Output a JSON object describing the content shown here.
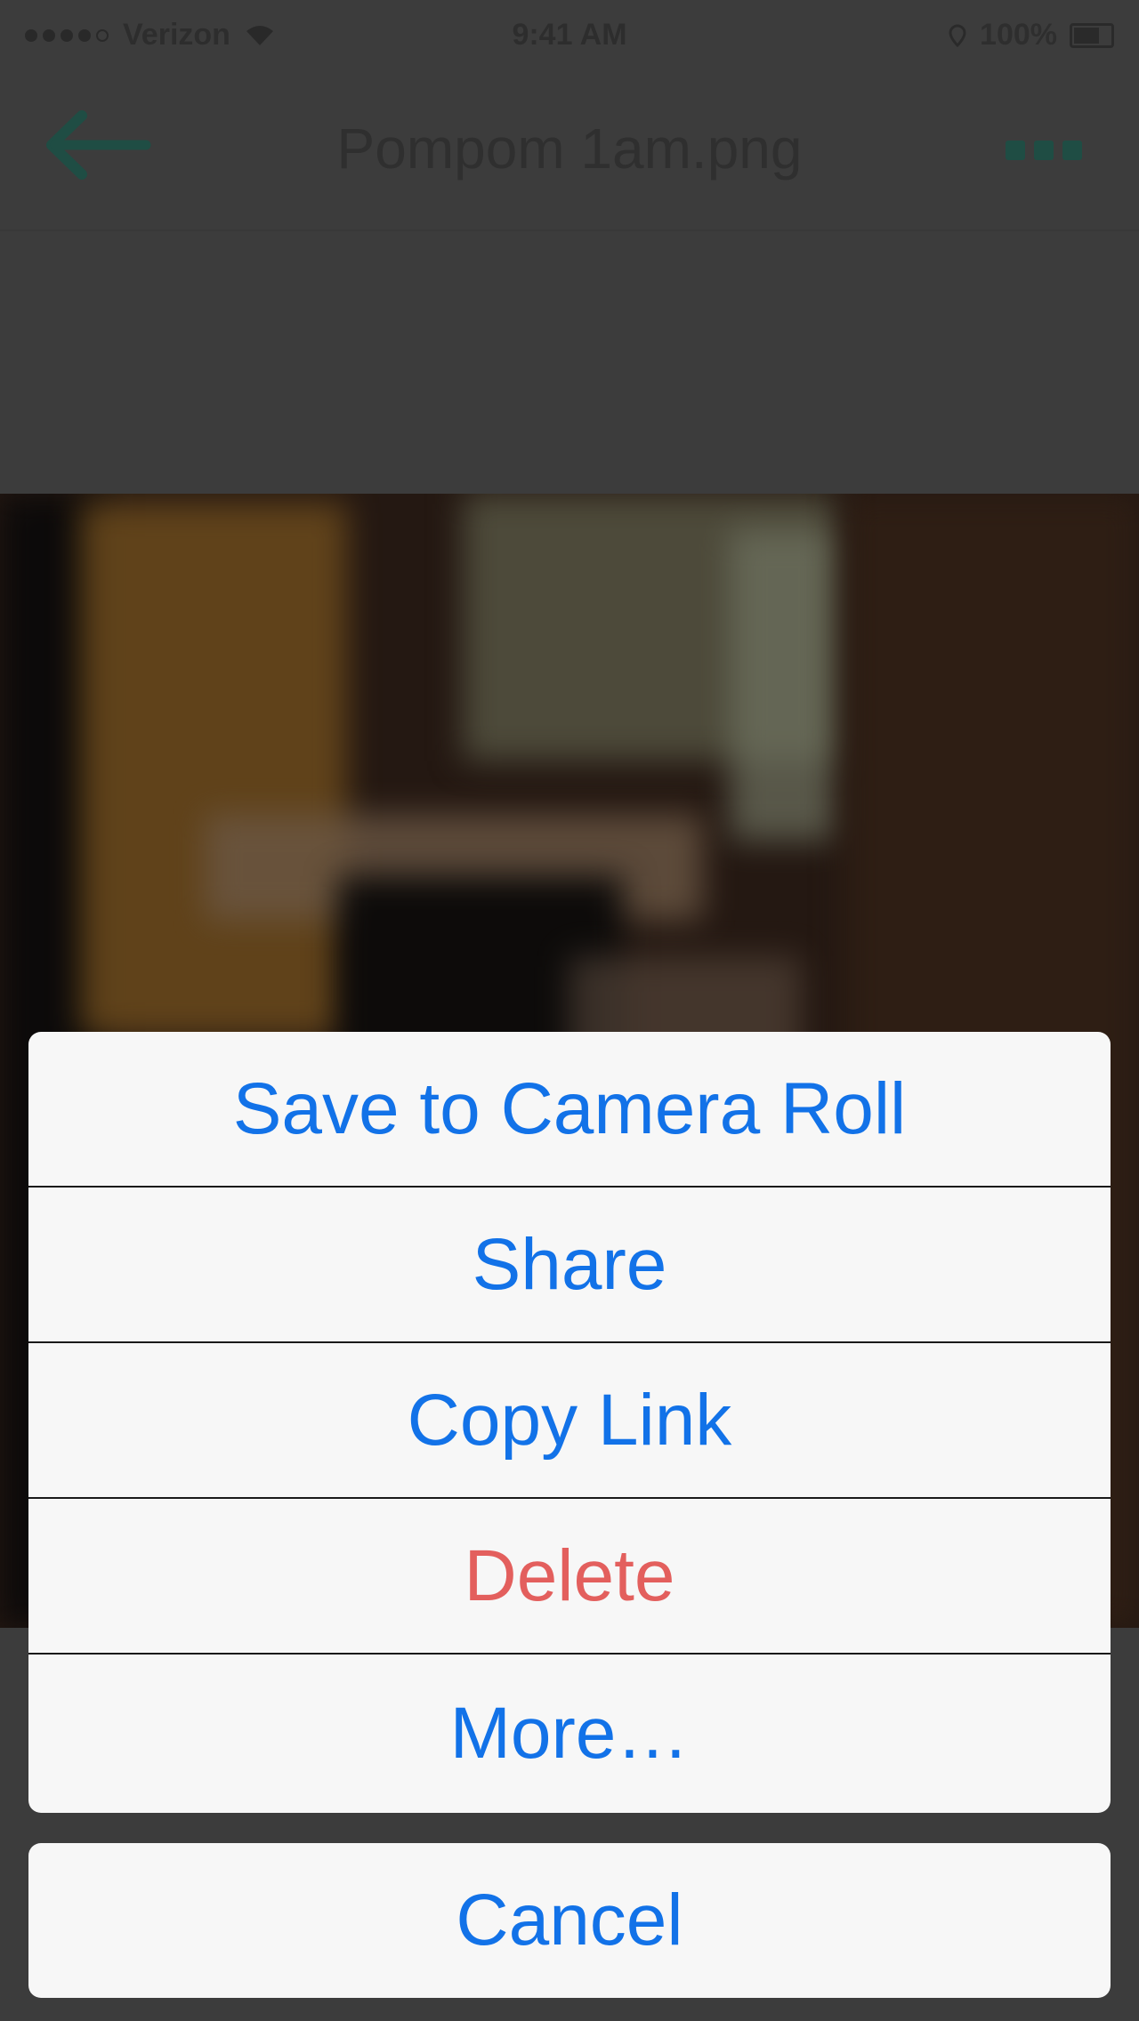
{
  "status_bar": {
    "carrier": "Verizon",
    "time": "9:41 AM",
    "battery": "100%"
  },
  "nav_bar": {
    "back_icon": "back-arrow-icon",
    "title": "Pompom 1am.png",
    "more_icon": "more-icon",
    "tint_color": "#1f6b5c"
  },
  "action_sheet": {
    "items": [
      {
        "label": "Save to Camera Roll",
        "style": "default"
      },
      {
        "label": "Share",
        "style": "default"
      },
      {
        "label": "Copy Link",
        "style": "default"
      },
      {
        "label": "Delete",
        "style": "destructive"
      },
      {
        "label": "More…",
        "style": "default"
      }
    ],
    "cancel_label": "Cancel",
    "colors": {
      "default": "#1272e8",
      "destructive": "#e35f5d",
      "background": "#f7f7f7"
    }
  }
}
